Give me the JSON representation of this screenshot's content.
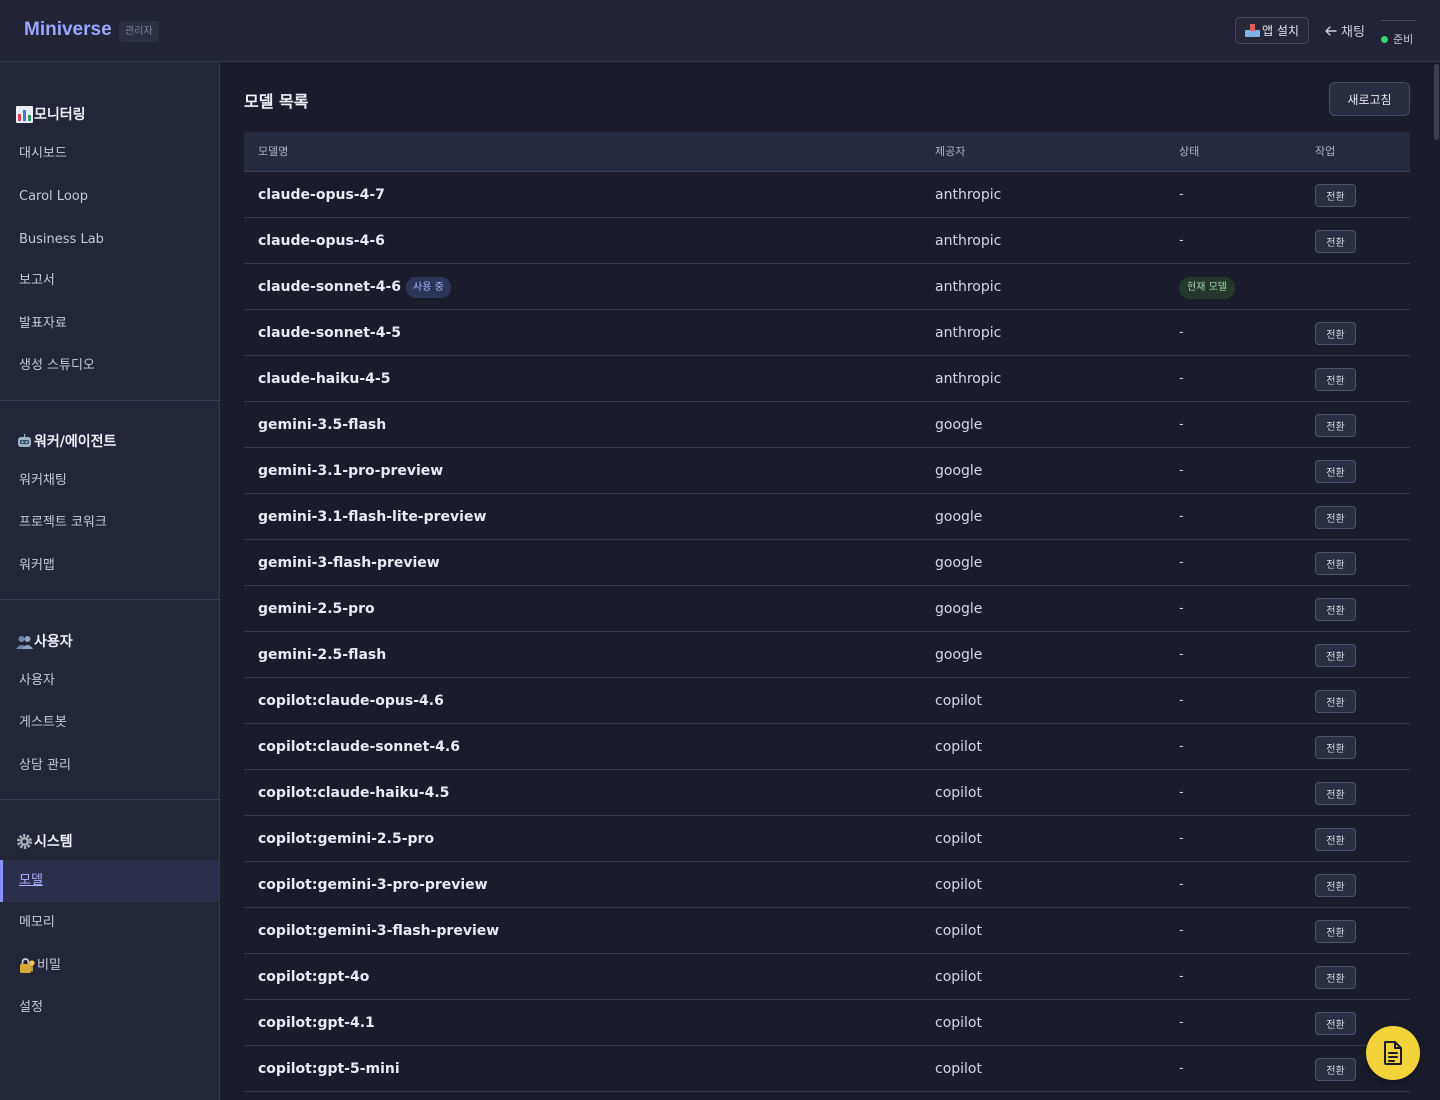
{
  "header": {
    "brand": "Miniverse",
    "role_badge": "관리자",
    "install_label": "앱 설치",
    "chat_label": "채팅",
    "status_label": "준비"
  },
  "sidebar": {
    "sections": [
      {
        "title": "모니터링",
        "icon": "bar-chart-icon",
        "items": [
          "대시보드",
          "Carol Loop",
          "Business Lab",
          "보고서",
          "발표자료",
          "생성 스튜디오"
        ]
      },
      {
        "title": "워커/에이전트",
        "icon": "robot-icon",
        "items": [
          "워커채팅",
          "프로젝트 코워크",
          "워커맵"
        ]
      },
      {
        "title": "사용자",
        "icon": "users-icon",
        "items": [
          "사용자",
          "게스트봇",
          "상담 관리"
        ]
      },
      {
        "title": "시스템",
        "icon": "gear-icon",
        "items": [
          "모델",
          "메모리",
          "비밀",
          "설정"
        ]
      }
    ],
    "active_item": "모델",
    "secret_icon": "lock-key-icon"
  },
  "main": {
    "title": "모델 목록",
    "refresh_label": "새로고침",
    "columns": [
      "모델명",
      "제공자",
      "상태",
      "작업"
    ],
    "in_use_badge": "사용 중",
    "current_badge": "현재 모델",
    "action_label": "전환",
    "empty_state": "-",
    "rows": [
      {
        "name": "claude-opus-4-7",
        "provider": "anthropic",
        "current": false
      },
      {
        "name": "claude-opus-4-6",
        "provider": "anthropic",
        "current": false
      },
      {
        "name": "claude-sonnet-4-6",
        "provider": "anthropic",
        "current": true
      },
      {
        "name": "claude-sonnet-4-5",
        "provider": "anthropic",
        "current": false
      },
      {
        "name": "claude-haiku-4-5",
        "provider": "anthropic",
        "current": false
      },
      {
        "name": "gemini-3.5-flash",
        "provider": "google",
        "current": false
      },
      {
        "name": "gemini-3.1-pro-preview",
        "provider": "google",
        "current": false
      },
      {
        "name": "gemini-3.1-flash-lite-preview",
        "provider": "google",
        "current": false
      },
      {
        "name": "gemini-3-flash-preview",
        "provider": "google",
        "current": false
      },
      {
        "name": "gemini-2.5-pro",
        "provider": "google",
        "current": false
      },
      {
        "name": "gemini-2.5-flash",
        "provider": "google",
        "current": false
      },
      {
        "name": "copilot:claude-opus-4.6",
        "provider": "copilot",
        "current": false
      },
      {
        "name": "copilot:claude-sonnet-4.6",
        "provider": "copilot",
        "current": false
      },
      {
        "name": "copilot:claude-haiku-4.5",
        "provider": "copilot",
        "current": false
      },
      {
        "name": "copilot:gemini-2.5-pro",
        "provider": "copilot",
        "current": false
      },
      {
        "name": "copilot:gemini-3-pro-preview",
        "provider": "copilot",
        "current": false
      },
      {
        "name": "copilot:gemini-3-flash-preview",
        "provider": "copilot",
        "current": false
      },
      {
        "name": "copilot:gpt-4o",
        "provider": "copilot",
        "current": false
      },
      {
        "name": "copilot:gpt-4.1",
        "provider": "copilot",
        "current": false
      },
      {
        "name": "copilot:gpt-5-mini",
        "provider": "copilot",
        "current": false
      }
    ]
  },
  "fab": {
    "icon": "document-icon"
  },
  "colors": {
    "accent": "#8a93ff",
    "brand": "#9aa6ff",
    "status_ready": "#3ecf6e",
    "fab": "#f4d23a"
  }
}
